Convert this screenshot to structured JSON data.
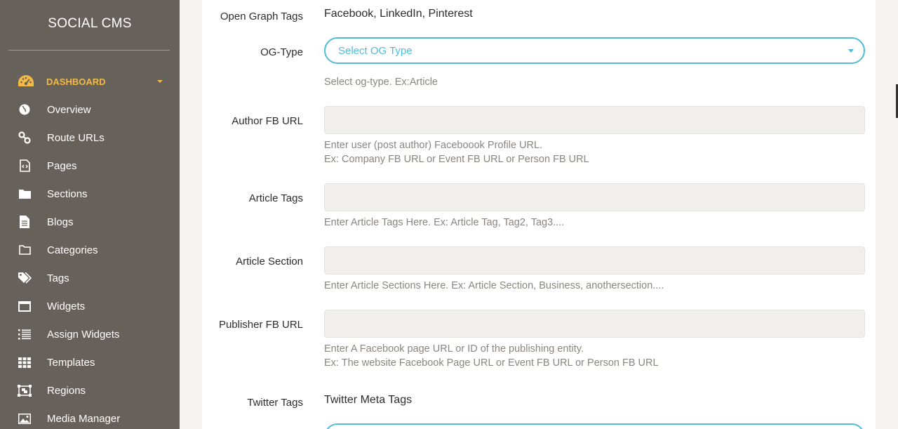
{
  "sidebar": {
    "brand": "SOCIAL CMS",
    "active": {
      "label": "DASHBOARD",
      "icon": "dashboard-gauge-icon"
    },
    "items": [
      {
        "label": "Overview",
        "icon": "globe-icon"
      },
      {
        "label": "Route URLs",
        "icon": "link-icon"
      },
      {
        "label": "Pages",
        "icon": "file-code-icon"
      },
      {
        "label": "Sections",
        "icon": "folder-icon"
      },
      {
        "label": "Blogs",
        "icon": "file-text-icon"
      },
      {
        "label": "Categories",
        "icon": "folder-outline-icon"
      },
      {
        "label": "Tags",
        "icon": "tags-icon"
      },
      {
        "label": "Widgets",
        "icon": "window-icon"
      },
      {
        "label": "Assign Widgets",
        "icon": "list-icon"
      },
      {
        "label": "Templates",
        "icon": "grid-icon"
      },
      {
        "label": "Regions",
        "icon": "object-group-icon"
      },
      {
        "label": "Media Manager",
        "icon": "image-icon"
      }
    ]
  },
  "form": {
    "og_tags": {
      "label": "Open Graph Tags",
      "value": "Facebook, LinkedIn, Pinterest"
    },
    "og_type": {
      "label": "OG-Type",
      "selected": "Select OG Type",
      "help": "Select og-type. Ex:Article"
    },
    "author_fb": {
      "label": "Author FB URL",
      "value": "",
      "help1": "Enter user (post author) Faceboook Profile URL.",
      "help2": "Ex: Company FB URL or Event FB URL or Person FB URL"
    },
    "article_tags": {
      "label": "Article Tags",
      "value": "",
      "help": "Enter Article Tags Here. Ex: Article Tag, Tag2, Tag3...."
    },
    "article_section": {
      "label": "Article Section",
      "value": "",
      "help": "Enter Article Sections Here. Ex: Article Section, Business, anothersection...."
    },
    "publisher_fb": {
      "label": "Publisher FB URL",
      "value": "",
      "help1": "Enter A Facebook page URL or ID of the publishing entity.",
      "help2": "Ex: The website Facebook Page URL or Event FB URL or Person FB URL"
    },
    "twitter_tags": {
      "label": "Twitter Tags",
      "value": "Twitter Meta Tags"
    }
  },
  "colors": {
    "sidebar": "#66615b",
    "active": "#f3bb45",
    "accent": "#51bcda"
  }
}
